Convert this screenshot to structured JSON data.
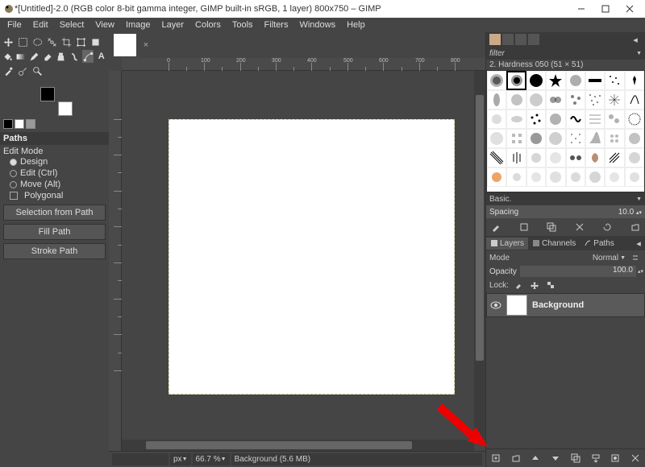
{
  "title": "*[Untitled]-2.0 (RGB color 8-bit gamma integer, GIMP built-in sRGB, 1 layer) 800x750 – GIMP",
  "menu": [
    "File",
    "Edit",
    "Select",
    "View",
    "Image",
    "Layer",
    "Colors",
    "Tools",
    "Filters",
    "Windows",
    "Help"
  ],
  "paths": {
    "header": "Paths",
    "edit_mode": "Edit Mode",
    "design": "Design",
    "edit": "Edit (Ctrl)",
    "move": "Move  (Alt)",
    "polygonal": "Polygonal",
    "selection": "Selection from Path",
    "fill": "Fill Path",
    "stroke": "Stroke Path"
  },
  "status": {
    "unit": "px",
    "zoom": "66.7 %",
    "layer": "Background (5.6 MB)"
  },
  "brushes": {
    "filter": "filter",
    "name": "2. Hardness 050 (51 × 51)",
    "category": "Basic.",
    "spacing_label": "Spacing",
    "spacing_value": "10.0"
  },
  "layers": {
    "tab_layers": "Layers",
    "tab_channels": "Channels",
    "tab_paths": "Paths",
    "mode_label": "Mode",
    "mode_value": "Normal",
    "opacity_label": "Opacity",
    "opacity_value": "100.0",
    "lock_label": "Lock:",
    "layer_name": "Background"
  }
}
